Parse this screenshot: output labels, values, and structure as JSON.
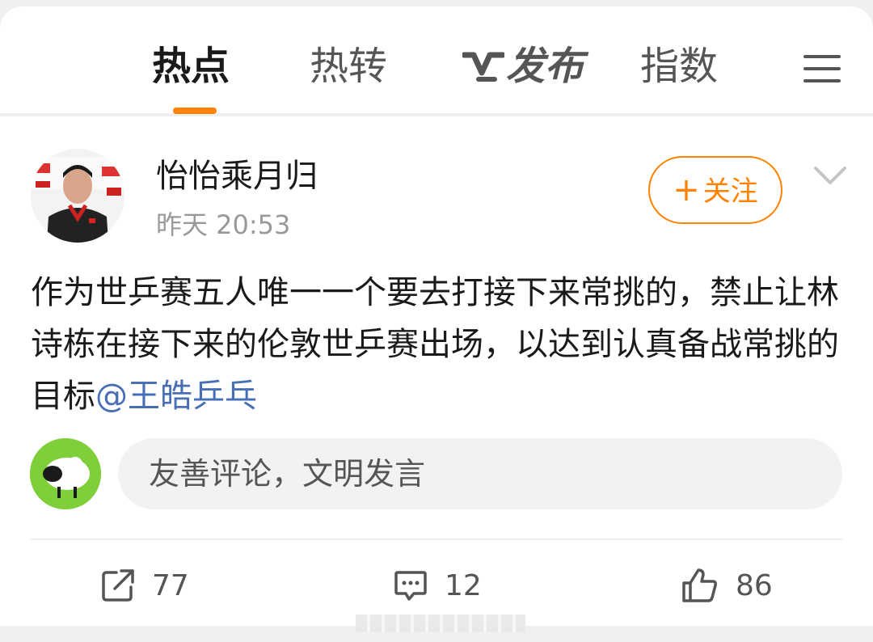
{
  "nav": {
    "tabs": [
      "热点",
      "热转",
      "发布",
      "指数"
    ],
    "active_tab": "热点",
    "accent_color": "#ff8200"
  },
  "post": {
    "author": "怡怡乘月归",
    "time": "昨天 20:53",
    "follow_label": "关注",
    "text": "作为世乒赛五人唯一一个要去打接下来常挑的，禁止让林诗栋在接下来的伦敦世乒赛出场，以达到认真备战常挑的目标",
    "mention": "@王皓乒乓",
    "comment_placeholder": "友善评论，文明发言"
  },
  "actions": {
    "forwards": "77",
    "comments": "12",
    "likes": "86"
  },
  "icons": [
    "menu-icon",
    "chevron-down-icon",
    "share-icon",
    "comment-icon",
    "like-icon"
  ]
}
